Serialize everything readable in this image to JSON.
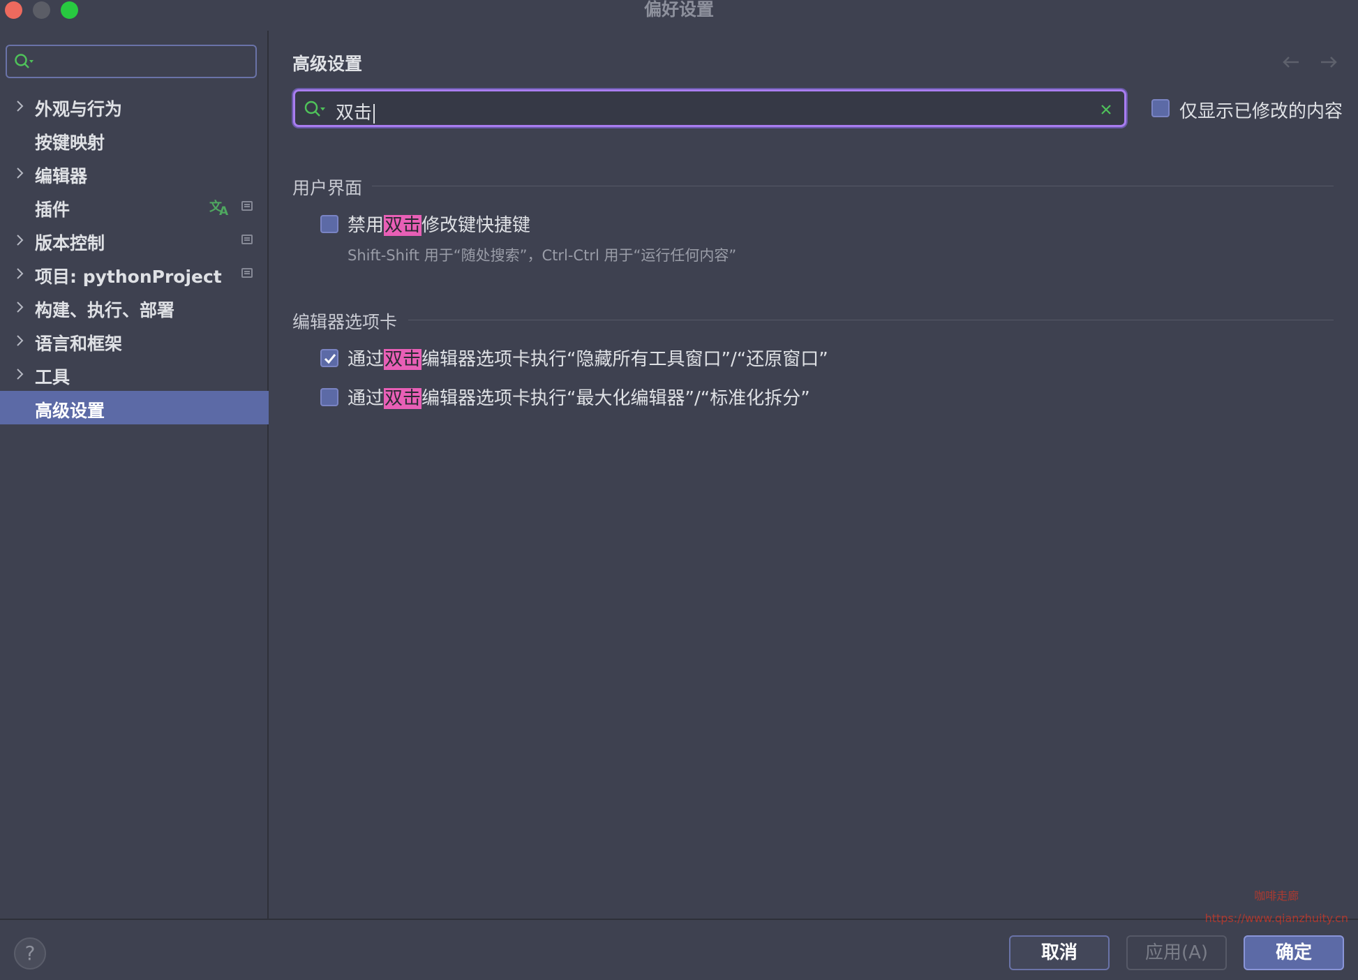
{
  "window": {
    "title": "偏好设置"
  },
  "sidebar": {
    "search_placeholder": "",
    "items": [
      {
        "label": "外观与行为"
      },
      {
        "label": "按键映射"
      },
      {
        "label": "编辑器"
      },
      {
        "label": "插件"
      },
      {
        "label": "版本控制"
      },
      {
        "label": "项目: pythonProject"
      },
      {
        "label": "构建、执行、部署"
      },
      {
        "label": "语言和框架"
      },
      {
        "label": "工具"
      },
      {
        "label": "高级设置"
      }
    ],
    "selected": "高级设置"
  },
  "main": {
    "title": "高级设置",
    "search_value": "双击",
    "modified_only_label": "仅显示已修改的内容",
    "modified_only_checked": false,
    "sections": [
      {
        "header": "用户界面",
        "options": [
          {
            "pre": "禁用",
            "highlight": "双击",
            "post": "修改键快捷键",
            "checked": false,
            "description": "Shift-Shift 用于“随处搜索”，Ctrl-Ctrl 用于“运行任何内容”"
          }
        ]
      },
      {
        "header": "编辑器选项卡",
        "options": [
          {
            "pre": "通过",
            "highlight": "双击",
            "post": "编辑器选项卡执行“隐藏所有工具窗口”/“还原窗口”",
            "checked": true
          },
          {
            "pre": "通过",
            "highlight": "双击",
            "post": "编辑器选项卡执行“最大化编辑器”/“标准化拆分”",
            "checked": false
          }
        ]
      }
    ]
  },
  "buttons": {
    "help": "?",
    "cancel": "取消",
    "apply": "应用(A)",
    "ok": "确定"
  },
  "watermark": {
    "line1": "咖啡走廊",
    "line2": "https://www.qianzhuity.cn"
  },
  "colors": {
    "background": "#3e4150",
    "selection": "#5c6aa6",
    "search_focus": "#a97df0",
    "highlight": "#e85fb6"
  }
}
